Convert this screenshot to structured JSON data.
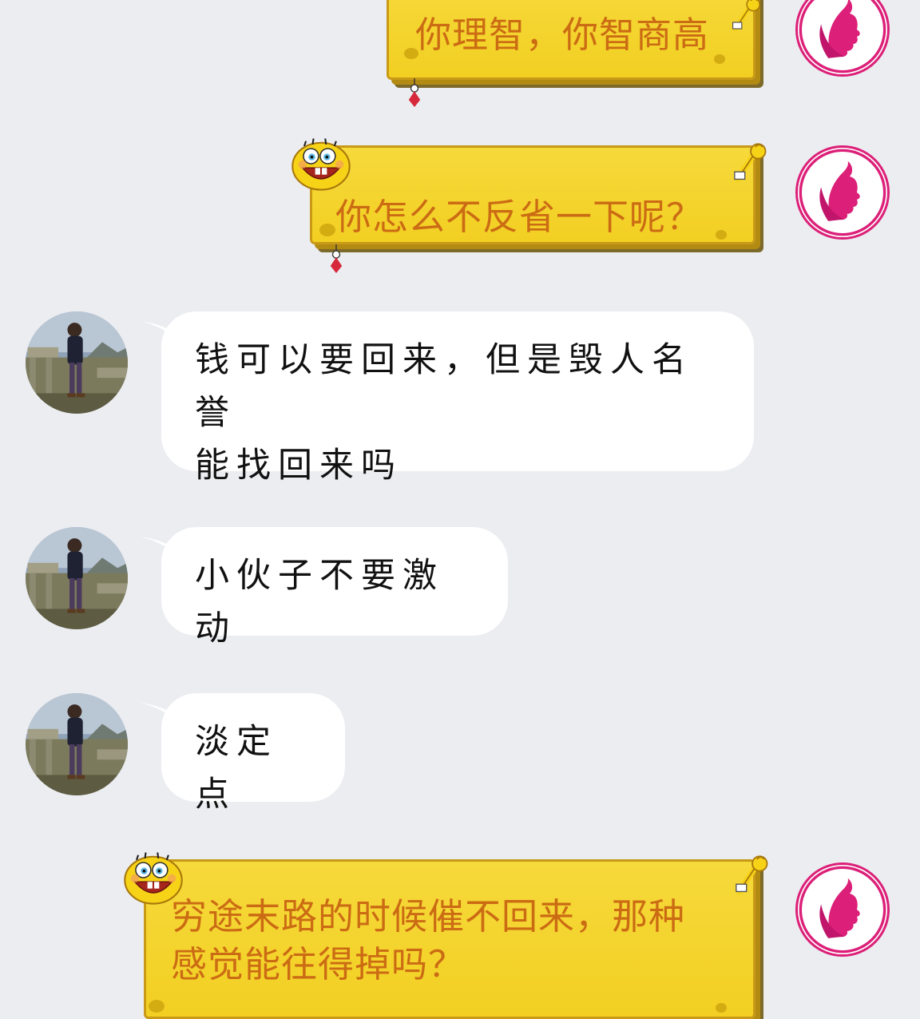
{
  "colors": {
    "background": "#ecedf1",
    "sponge_yellow": "#f2cf22",
    "sponge_text": "#cb6b14",
    "avatar_pink": "#dc1f78"
  },
  "messages": [
    {
      "side": "right",
      "text": "你理智，你智商高",
      "avatar_icon": "woman-profile-icon"
    },
    {
      "side": "right",
      "text": "你怎么不反省一下呢？",
      "avatar_icon": "woman-profile-icon"
    },
    {
      "side": "left",
      "text_lines": [
        "钱可以要回来，但是毁人名誉",
        "能找回来吗"
      ],
      "avatar_icon": "man-photo-avatar"
    },
    {
      "side": "left",
      "text": "小伙子不要激动",
      "avatar_icon": "man-photo-avatar"
    },
    {
      "side": "left",
      "text": "淡定点",
      "avatar_icon": "man-photo-avatar"
    },
    {
      "side": "right",
      "text_lines": [
        "穷途末路的时候催不回来，那种",
        "感觉能往得掉吗？"
      ],
      "avatar_icon": "woman-profile-icon"
    }
  ]
}
